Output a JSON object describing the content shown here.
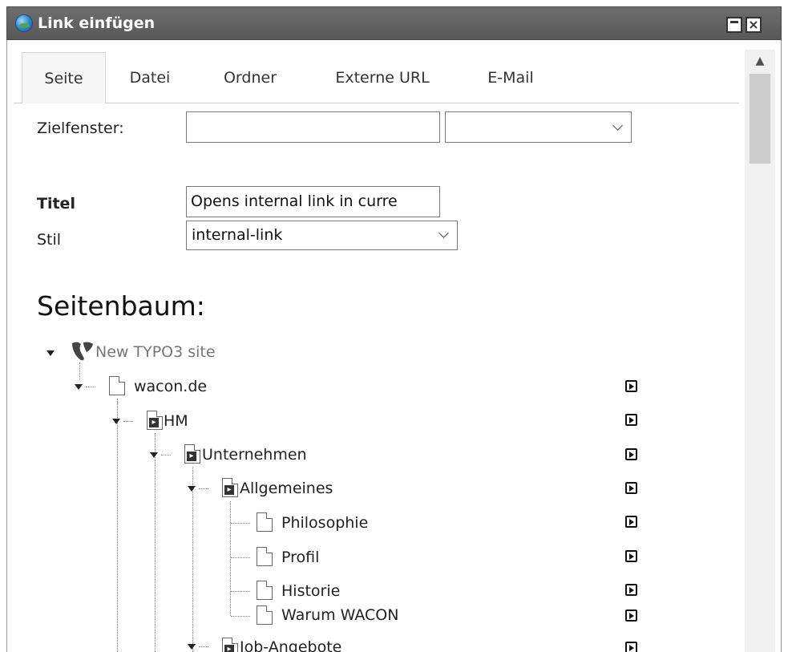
{
  "window": {
    "title": "Link einfügen",
    "icon": "globe-link-icon"
  },
  "tabs": [
    {
      "label": "Seite",
      "active": true
    },
    {
      "label": "Datei",
      "active": false
    },
    {
      "label": "Ordner",
      "active": false
    },
    {
      "label": "Externe URL",
      "active": false
    },
    {
      "label": "E-Mail",
      "active": false
    }
  ],
  "form": {
    "zielfenster_label": "Zielfenster:",
    "zielfenster_value": "",
    "zielfenster_select_value": "",
    "titel_label": "Titel",
    "titel_value": "Opens internal link in curre",
    "stil_label": "Stil",
    "stil_value": "internal-link"
  },
  "tree": {
    "heading": "Seitenbaum:",
    "root": "New TYPO3 site",
    "nodes": [
      {
        "label": "wacon.de"
      },
      {
        "label": "HM"
      },
      {
        "label": "Unternehmen"
      },
      {
        "label": "Allgemeines"
      },
      {
        "label": "Philosophie"
      },
      {
        "label": "Profil"
      },
      {
        "label": "Historie"
      },
      {
        "label": "Warum WACON"
      },
      {
        "label": "Job-Angebote"
      }
    ]
  },
  "colors": {
    "titlebar": "#606060",
    "tab_active_bg": "#f6f6f6"
  }
}
